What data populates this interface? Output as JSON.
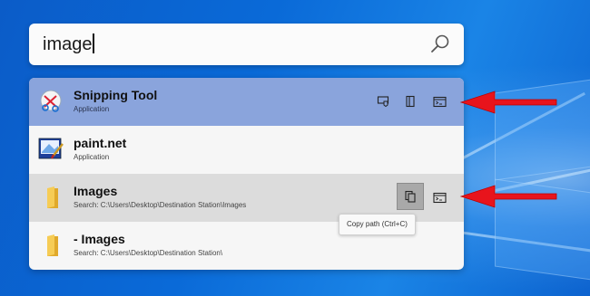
{
  "search": {
    "query": "image"
  },
  "results": [
    {
      "title": "Snipping Tool",
      "subtitle": "Application",
      "icon": "snipping-tool-icon",
      "state": "selected",
      "actions": [
        "run-as-admin-icon",
        "open-containing-folder-icon",
        "run-in-console-icon"
      ]
    },
    {
      "title": "paint.net",
      "subtitle": "Application",
      "icon": "paint-net-icon",
      "state": "normal",
      "actions": []
    },
    {
      "title": "Images",
      "subtitle": "Search: C:\\Users\\Desktop\\Destination Station\\Images",
      "icon": "folder-icon",
      "state": "hover",
      "actions": [
        "copy-path-icon",
        "open-in-console-icon"
      ]
    },
    {
      "title": "- Images",
      "subtitle": "Search: C:\\Users\\Desktop\\Destination Station\\",
      "icon": "folder-icon",
      "state": "normal",
      "actions": []
    }
  ],
  "tooltip": {
    "text": "Copy path (Ctrl+C)"
  },
  "colors": {
    "selected_row": "#8aa4dc",
    "hover_row": "#dcdcdc",
    "arrow": "#e8141c",
    "desktop": "#0a6ad6"
  }
}
